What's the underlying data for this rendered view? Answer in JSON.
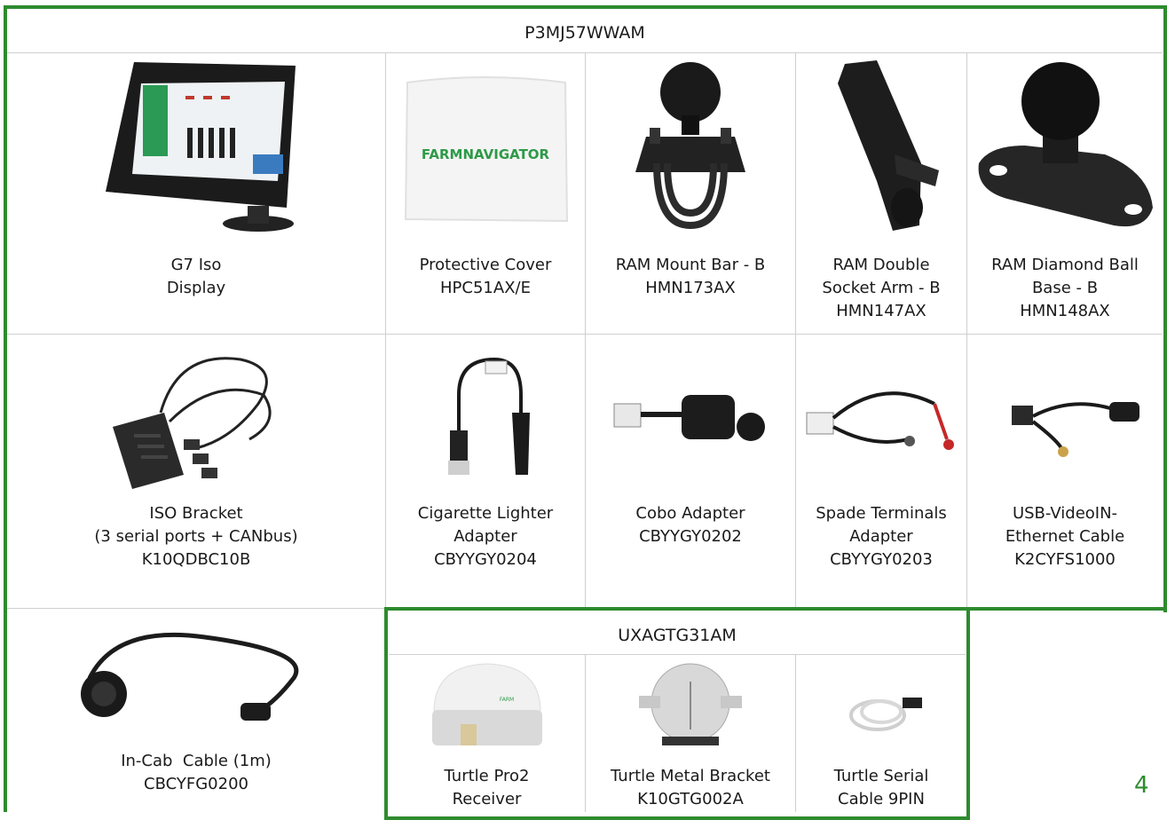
{
  "kit_main": {
    "code": "P3MJ57WWAM",
    "items": [
      {
        "lines": [
          "G7 Iso",
          "Display"
        ],
        "image": "g7-iso-display-image"
      },
      {
        "lines": [
          "Protective Cover",
          "HPC51AX/E"
        ],
        "image": "protective-cover-image",
        "logo_text": "FARMNAVIGATOR"
      },
      {
        "lines": [
          "RAM Mount Bar - B",
          "HMN173AX"
        ],
        "image": "ram-mount-bar-image"
      },
      {
        "lines": [
          "RAM Double",
          "Socket Arm - B",
          "HMN147AX"
        ],
        "image": "ram-double-socket-arm-image"
      },
      {
        "lines": [
          "RAM Diamond Ball",
          "Base - B",
          "HMN148AX"
        ],
        "image": "ram-diamond-ball-base-image"
      },
      {
        "lines": [
          "ISO Bracket",
          "(3 serial ports + CANbus)",
          "K10QDBC10B"
        ],
        "image": "iso-bracket-image"
      },
      {
        "lines": [
          "Cigarette Lighter",
          "Adapter",
          "CBYYGY0204"
        ],
        "image": "cigarette-lighter-adapter-image"
      },
      {
        "lines": [
          "Cobo Adapter",
          "CBYYGY0202"
        ],
        "image": "cobo-adapter-image"
      },
      {
        "lines": [
          "Spade Terminals",
          "Adapter",
          "CBYYGY0203"
        ],
        "image": "spade-terminals-adapter-image"
      },
      {
        "lines": [
          "USB-VideoIN-",
          "Ethernet Cable",
          "K2CYFS1000"
        ],
        "image": "usb-videoin-ethernet-cable-image"
      },
      {
        "lines": [
          "In-Cab  Cable (1m)",
          "CBCYFG0200"
        ],
        "image": "in-cab-cable-image"
      }
    ]
  },
  "kit_receiver": {
    "code": "UXAGTG31AM",
    "items": [
      {
        "lines": [
          "Turtle Pro2",
          "Receiver"
        ],
        "image": "turtle-pro2-receiver-image"
      },
      {
        "lines": [
          "Turtle Metal Bracket",
          "K10GTG002A"
        ],
        "image": "turtle-metal-bracket-image"
      },
      {
        "lines": [
          "Turtle Serial",
          "Cable 9PIN"
        ],
        "image": "turtle-serial-cable-image"
      }
    ]
  },
  "page_number": "4",
  "colors": {
    "frame": "#2e8b2e",
    "grid": "#cfcfcf"
  }
}
